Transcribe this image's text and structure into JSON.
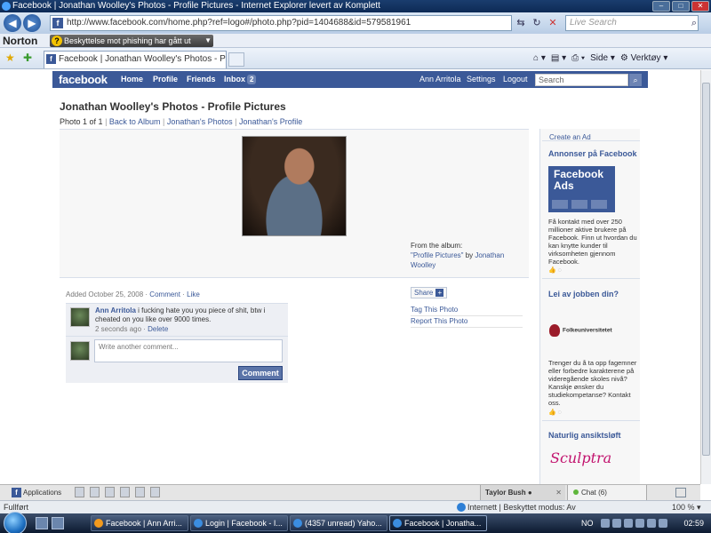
{
  "window": {
    "title": "Facebook | Jonathan Woolley's Photos - Profile Pictures - Internet Explorer levert av Komplett",
    "controls": [
      "–",
      "□",
      "✕"
    ]
  },
  "browser": {
    "url": "http://www.facebook.com/home.php?ref=logo#/photo.php?pid=1404688&id=579581961",
    "search_placeholder": "Live Search",
    "tab_title": "Facebook | Jonathan Woolley's Photos - Profile Pi...",
    "commands": [
      "Side",
      "Verktøy"
    ],
    "norton": {
      "logo": "Norton",
      "warning": "Beskyttelse mot phishing har gått ut"
    }
  },
  "facebook": {
    "logo": "facebook",
    "nav": {
      "home": "Home",
      "profile": "Profile",
      "friends": "Friends",
      "inbox": "Inbox",
      "inbox_count": "2"
    },
    "user_nav": {
      "name": "Ann Arritola",
      "settings": "Settings",
      "logout": "Logout"
    },
    "search_placeholder": "Search",
    "page_title": "Jonathan Woolley's Photos - Profile Pictures",
    "photo_nav": {
      "counter": "Photo 1 of 1",
      "back_to_album": "Back to Album",
      "owner_photos": "Jonathan's Photos",
      "owner_profile": "Jonathan's Profile"
    },
    "album": {
      "from_label": "From the album:",
      "album_name": "\"Profile Pictures\"",
      "by": "by",
      "owner_first": "Jonathan",
      "owner_last": "Woolley"
    },
    "added": {
      "date": "Added October 25, 2008",
      "comment_link": "Comment",
      "like_link": "Like"
    },
    "comments": [
      {
        "author": "Ann Arritola",
        "text": "i fucking hate you you piece of shit, btw i cheated on you like over 9000 times.",
        "time": "2 seconds ago",
        "delete": "Delete"
      }
    ],
    "comment_input_placeholder": "Write another comment...",
    "comment_button": "Comment",
    "share": "Share",
    "tag_photo": "Tag This Photo",
    "report_photo": "Report This Photo"
  },
  "ads": {
    "create_ad": "Create an Ad",
    "ad1": {
      "title": "Annonser på Facebook",
      "image_text_line1": "Facebook",
      "image_text_line2": "Ads",
      "text": "Få kontakt med over 250 millioner aktive brukere på Facebook. Finn ut hvordan du kan knytte kunder til virksomheten gjennom Facebook."
    },
    "ad2": {
      "title": "Lei av jobben din?",
      "logo_text": "Folkeuniversitetet",
      "text": "Trenger du å ta opp fagemner eller forbedre karakterene på videregående skoles nivå? Kanskje ønsker du studiekompetanse? Kontakt oss."
    },
    "ad3": {
      "title": "Naturlig ansiktsløft",
      "logo_text": "Sculptra"
    }
  },
  "chatbar": {
    "applications": "Applications",
    "friend_tab": "Taylor Bush",
    "chat_label": "Chat",
    "online_count": "(6)"
  },
  "statusbar": {
    "left": "Fullført",
    "zone": "Internett | Beskyttet modus: Av",
    "zoom": "100 %"
  },
  "taskbar": {
    "buttons": [
      "Facebook | Ann Arri...",
      "Login | Facebook - I...",
      "(4357 unread) Yaho...",
      "Facebook | Jonatha..."
    ],
    "language": "NO",
    "time": "02:59"
  }
}
